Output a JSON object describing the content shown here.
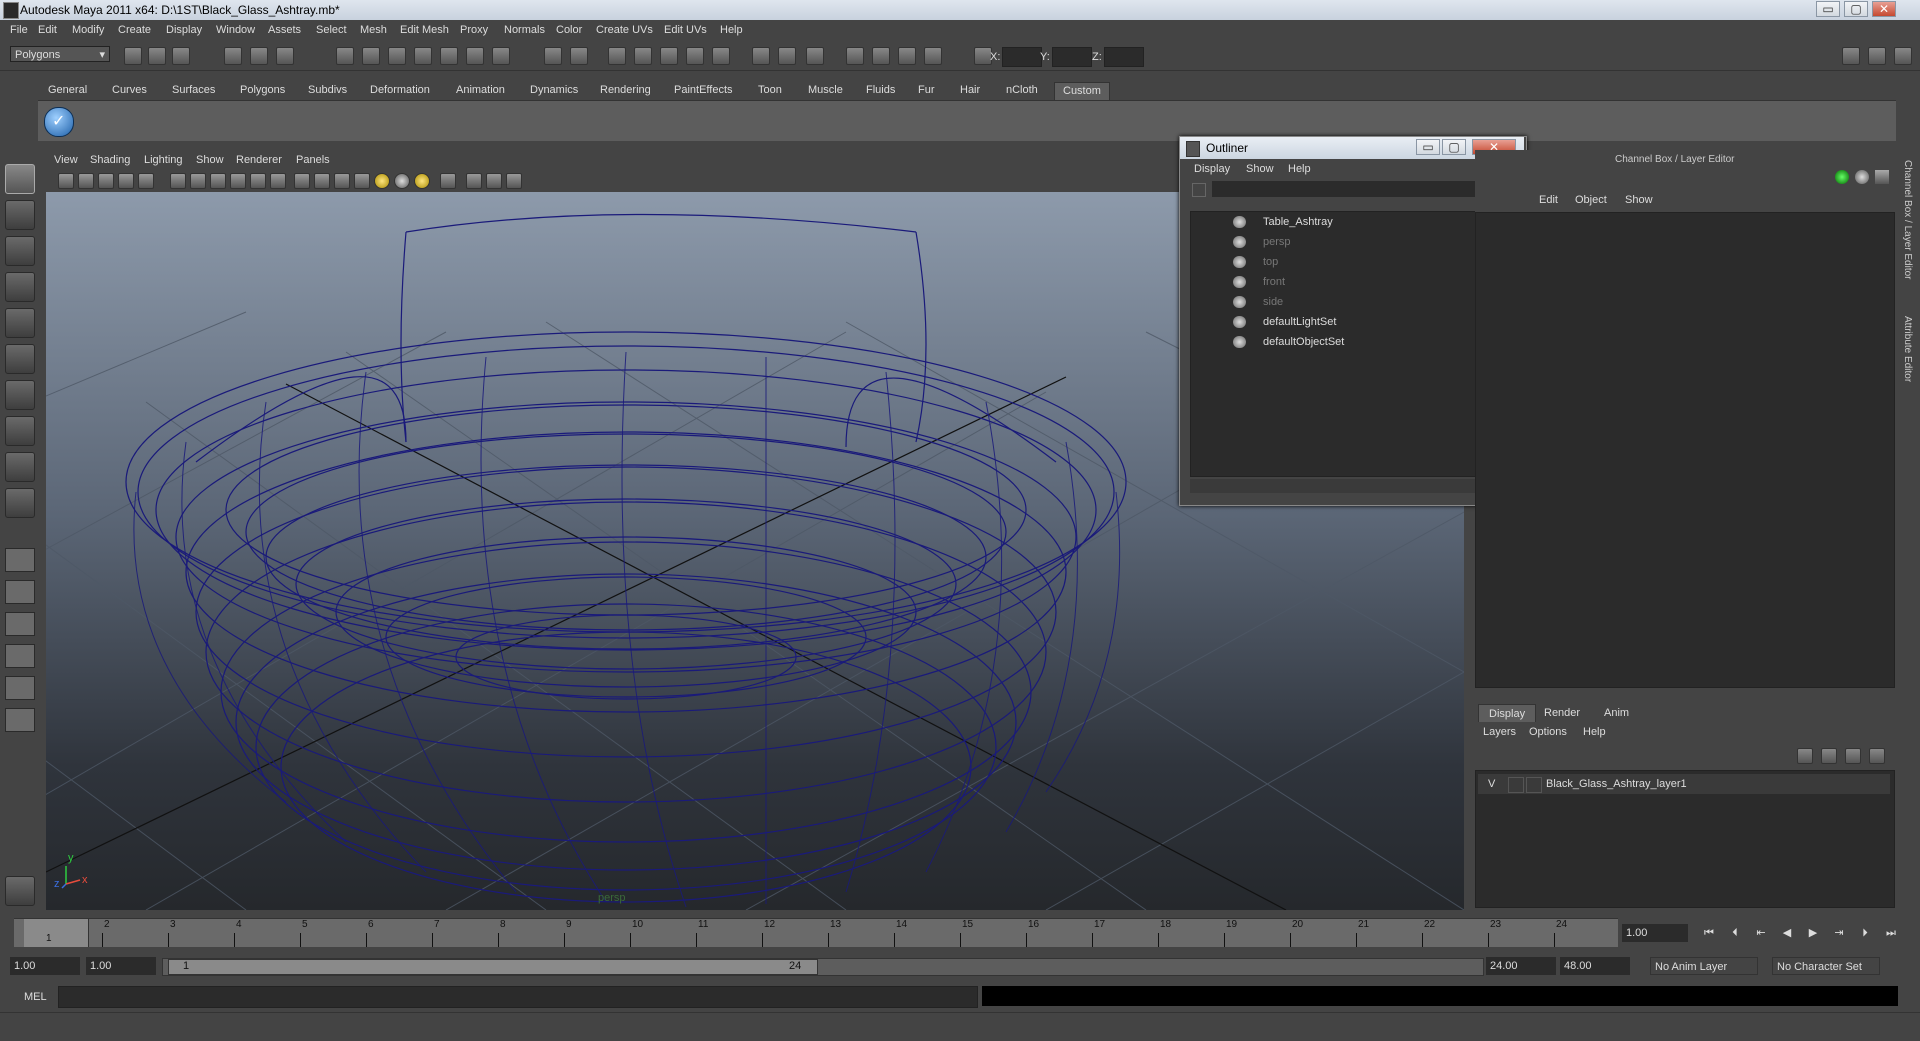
{
  "window": {
    "title": "Autodesk Maya 2011 x64: D:\\1ST\\Black_Glass_Ashtray.mb*",
    "min_label": "▭",
    "max_label": "▢",
    "close_label": "✕"
  },
  "menubar": [
    "File",
    "Edit",
    "Modify",
    "Create",
    "Display",
    "Window",
    "Assets",
    "Select",
    "Mesh",
    "Edit Mesh",
    "Proxy",
    "Normals",
    "Color",
    "Create UVs",
    "Edit UVs",
    "Help"
  ],
  "status": {
    "mode": "Polygons",
    "x_label": "X:",
    "y_label": "Y:",
    "z_label": "Z:"
  },
  "shelf_tabs": [
    "General",
    "Curves",
    "Surfaces",
    "Polygons",
    "Subdivs",
    "Deformation",
    "Animation",
    "Dynamics",
    "Rendering",
    "PaintEffects",
    "Toon",
    "Muscle",
    "Fluids",
    "Fur",
    "Hair",
    "nCloth",
    "Custom"
  ],
  "shelf_active": "Custom",
  "panel_menu": [
    "View",
    "Shading",
    "Lighting",
    "Show",
    "Renderer",
    "Panels"
  ],
  "viewport": {
    "camera_label": "persp",
    "axis_y": "y",
    "axis_x": "x",
    "axis_z": "z"
  },
  "outliner": {
    "title": "Outliner",
    "menu": [
      "Display",
      "Show",
      "Help"
    ],
    "items": [
      {
        "label": "Table_Ashtray",
        "dim": false
      },
      {
        "label": "persp",
        "dim": true
      },
      {
        "label": "top",
        "dim": true
      },
      {
        "label": "front",
        "dim": true
      },
      {
        "label": "side",
        "dim": true
      },
      {
        "label": "defaultLightSet",
        "dim": false
      },
      {
        "label": "defaultObjectSet",
        "dim": false
      }
    ]
  },
  "channel_box": {
    "title": "Channel Box / Layer Editor",
    "menu": [
      "Edit",
      "Object",
      "Show"
    ],
    "side_tab_1": "Channel Box / Layer Editor",
    "side_tab_2": "Attribute Editor"
  },
  "layer_editor": {
    "tabs": [
      "Display",
      "Render",
      "Anim"
    ],
    "active_tab": "Display",
    "menu": [
      "Layers",
      "Options",
      "Help"
    ],
    "layer_visible": "V",
    "layer_name": "Black_Glass_Ashtray_layer1"
  },
  "time_slider": {
    "ticks": [
      1,
      2,
      3,
      4,
      5,
      6,
      7,
      8,
      9,
      10,
      11,
      12,
      13,
      14,
      15,
      16,
      17,
      18,
      19,
      20,
      21,
      22,
      23,
      24
    ],
    "current_marker": "1",
    "current_frame": "1.00"
  },
  "range_slider": {
    "start_time": "1.00",
    "playback_start": "1.00",
    "range_start_label": "1",
    "range_end_label": "24",
    "playback_end": "24.00",
    "end_time": "48.00",
    "anim_layer": "No Anim Layer",
    "character_set": "No Character Set"
  },
  "command_line": {
    "label": "MEL"
  }
}
